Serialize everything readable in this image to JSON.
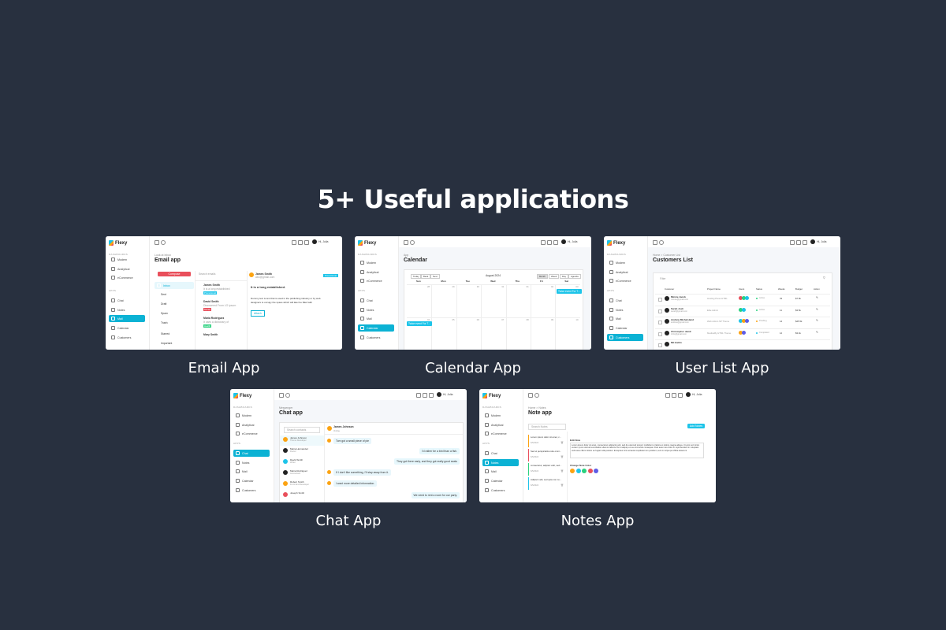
{
  "heading": "5+ Useful applications",
  "captions": {
    "email": "Email App",
    "calendar": "Calendar App",
    "userlist": "User List App",
    "chat": "Chat App",
    "notes": "Notes App"
  },
  "common": {
    "brand": "Flexy",
    "section_dashboards": "DASHBOARDS",
    "section_apps": "APPS",
    "nav": [
      "Modern",
      "Analytical",
      "eCommerce",
      "Chat",
      "Notes",
      "Mail",
      "Calendar",
      "Customers"
    ],
    "greeting": "Hi, Julia"
  },
  "email": {
    "crumb": "Look at Inbox",
    "title": "Email app",
    "compose": "Compose",
    "search": "Search emails",
    "folders": [
      "Inbox",
      "Sent",
      "Draft",
      "Spam",
      "Trash",
      "Starred",
      "Important"
    ],
    "mails": [
      {
        "name": "James Smith",
        "snippet": "It is a long established",
        "tag": "Promotional"
      },
      {
        "name": "David Smith",
        "snippet": "Discovered From LO ipsum",
        "tag": "Social"
      },
      {
        "name": "Maria Rodriguez",
        "snippet": "It uses a dictionary of",
        "tag": "Health"
      },
      {
        "name": "Mary Smith",
        "snippet": "",
        "tag": ""
      }
    ],
    "reader_name": "James Smith",
    "reader_email": "abc@gmail.com",
    "reader_tag": "Promotional",
    "reader_subject": "It is a long established.",
    "reader_body_1": "Dummy text is text that is used in the publishing industry or by web",
    "reader_body_2": "designers to occupy the space which will later be filled with",
    "reader_attach": "Attach"
  },
  "calendar": {
    "crumb": "App",
    "title": "Calendar",
    "nav_buttons": [
      "Today",
      "Back",
      "Next"
    ],
    "month": "August 2024",
    "views": [
      "Month",
      "Week",
      "Day",
      "Agenda"
    ],
    "days": [
      "Sun",
      "Mon",
      "Tue",
      "Wed",
      "Thu",
      "Fri",
      "Sat"
    ],
    "week1": [
      "28",
      "29",
      "30",
      "31",
      "01",
      "02",
      "03"
    ],
    "week2": [
      "04",
      "05",
      "06",
      "07",
      "08",
      "09",
      "10"
    ],
    "event1": "Twice event For T...",
    "event2": "Twice event For T..."
  },
  "userlist": {
    "crumb": "Home > Customer List",
    "title": "Customers List",
    "search": "Filter",
    "columns": [
      "Customer",
      "Project Name",
      "Users",
      "Status",
      "Weeks",
      "Budget",
      "Action"
    ],
    "rows": [
      {
        "name": "Minnie Jacob",
        "email": "minnie@gmail.com",
        "project": "Hosting Press HTML",
        "status": "Active",
        "weeks": "33",
        "budget": "$7.9k"
      },
      {
        "name": "Sarah Josh",
        "email": "sarah@gmail.com",
        "project": "Elite Admin",
        "status": "Active",
        "weeks": "11",
        "budget": "$3.5k"
      },
      {
        "name": "Andrew Michelsland",
        "email": "andrew@gmail.com",
        "project": "Web Admin SP Theme",
        "status": "Pending",
        "weeks": "14",
        "budget": "$45.5k"
      },
      {
        "name": "Christopher Jamil",
        "email": "chris@gmail.com",
        "project": "Medicalfly HTML Theme",
        "status": "Completed",
        "weeks": "12",
        "budget": "$3.4k"
      },
      {
        "name": "Mit Hattin",
        "email": "",
        "project": "",
        "status": "",
        "weeks": "",
        "budget": ""
      }
    ],
    "status_colors": {
      "Active": "#2bd17e",
      "Pending": "#fca311",
      "Completed": "#1dc4e9"
    }
  },
  "chat": {
    "crumb": "Messenger",
    "title": "Chat app",
    "search": "Search contacts",
    "contacts": [
      {
        "name": "James Johnson",
        "role": "Theme Developer"
      },
      {
        "name": "Maria Hernandez",
        "role": "Doctor"
      },
      {
        "name": "David Smith",
        "role": "Writer"
      },
      {
        "name": "Maria Rodriguez",
        "role": "Accountant"
      },
      {
        "name": "Robert Smith",
        "role": "Front End Developer"
      },
      {
        "name": "Joseph Smith",
        "role": ""
      }
    ],
    "header_name": "James Johnson",
    "header_status": "Online",
    "messages": [
      {
        "text": "Tom got a small piece of pie",
        "side": "left"
      },
      {
        "text": "I'd rather be a bird than a fish.",
        "side": "right"
      },
      {
        "text": "They got there early, and they got really good seats",
        "side": "right"
      },
      {
        "text": "If I don't like something, I'll stay away from it.",
        "side": "left"
      },
      {
        "text": "I want more detailed information.",
        "side": "left"
      },
      {
        "text": "We need to rent a room for our party.",
        "side": "right"
      }
    ]
  },
  "notes": {
    "crumb": "Home > Notes",
    "title": "Note app",
    "search": "Search Notes",
    "add": "Add Notes",
    "items": [
      {
        "text": "Lorem ipsum dolor sit amet, c...",
        "date": "6/5/2024",
        "color": "#fca311"
      },
      {
        "text": "Sed ut perspiciatis unde omni...",
        "date": "6/5/2024",
        "color": "#e94f5b"
      },
      {
        "text": "consectetur, adipisci velit, sed...",
        "date": "6/5/2024",
        "color": "#2bd17e"
      },
      {
        "text": "Adipisci velit, sed quia non nu...",
        "date": "6/5/2024",
        "color": "#1dc4e9"
      }
    ],
    "edit_label": "Edit Note",
    "body": "Lorem ipsum dolor sit amet, consectetur adipiscing elit, sed do eiusmod tempor incididunt ut labore et dolore magna aliqua. Ut enim ad minim veniam, quis nostrud exercitation ullamco laboris nisi ut aliquip ex ea commodo consequat. Duis aute irure dolor in reprehenderit in voluptate velit esse cillum dolore eu fugiat nulla pariatur. Excepteur sint occaecat cupidatat non proident, sunt in culpa qui officia deserunt",
    "color_label": "Change Note Color",
    "swatches": [
      "#fca311",
      "#1dc4e9",
      "#2bd17e",
      "#e94f5b",
      "#5e5ce6"
    ]
  }
}
